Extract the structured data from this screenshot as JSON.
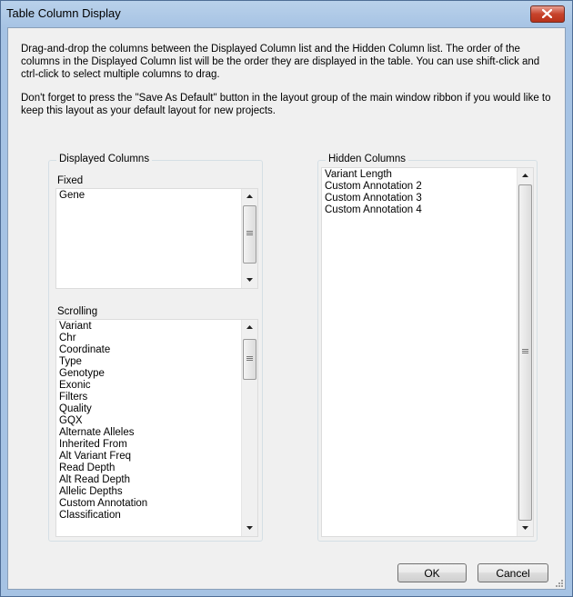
{
  "window": {
    "title": "Table Column Display"
  },
  "instructions": {
    "para1": "Drag-and-drop the columns between the Displayed Column list and the Hidden Column list.   The order of the columns in the Displayed Column list will be the order they are displayed in the table.  You can use shift-click and ctrl-click to select multiple columns to drag.",
    "para2": "Don't forget to press the \"Save As Default\" button in the layout group of the main window ribbon if you would like to keep this layout as your default layout for new projects."
  },
  "displayed": {
    "label": "Displayed Columns",
    "fixed": {
      "label": "Fixed",
      "items": [
        "Gene"
      ]
    },
    "scrolling": {
      "label": "Scrolling",
      "items": [
        "Variant",
        "Chr",
        "Coordinate",
        "Type",
        "Genotype",
        "Exonic",
        "Filters",
        "Quality",
        "GQX",
        "Alternate Alleles",
        "Inherited From",
        "Alt Variant Freq",
        "Read Depth",
        "Alt Read Depth",
        "Allelic Depths",
        "Custom Annotation",
        "Classification"
      ]
    }
  },
  "hidden": {
    "label": "Hidden Columns",
    "items": [
      "Variant Length",
      "Custom Annotation 2",
      "Custom Annotation 3",
      "Custom Annotation 4"
    ]
  },
  "buttons": {
    "ok": "OK",
    "cancel": "Cancel"
  },
  "icons": {
    "close": "close-icon",
    "up": "scroll-up-arrow-icon",
    "down": "scroll-down-arrow-icon",
    "grip": "resize-grip-icon"
  }
}
